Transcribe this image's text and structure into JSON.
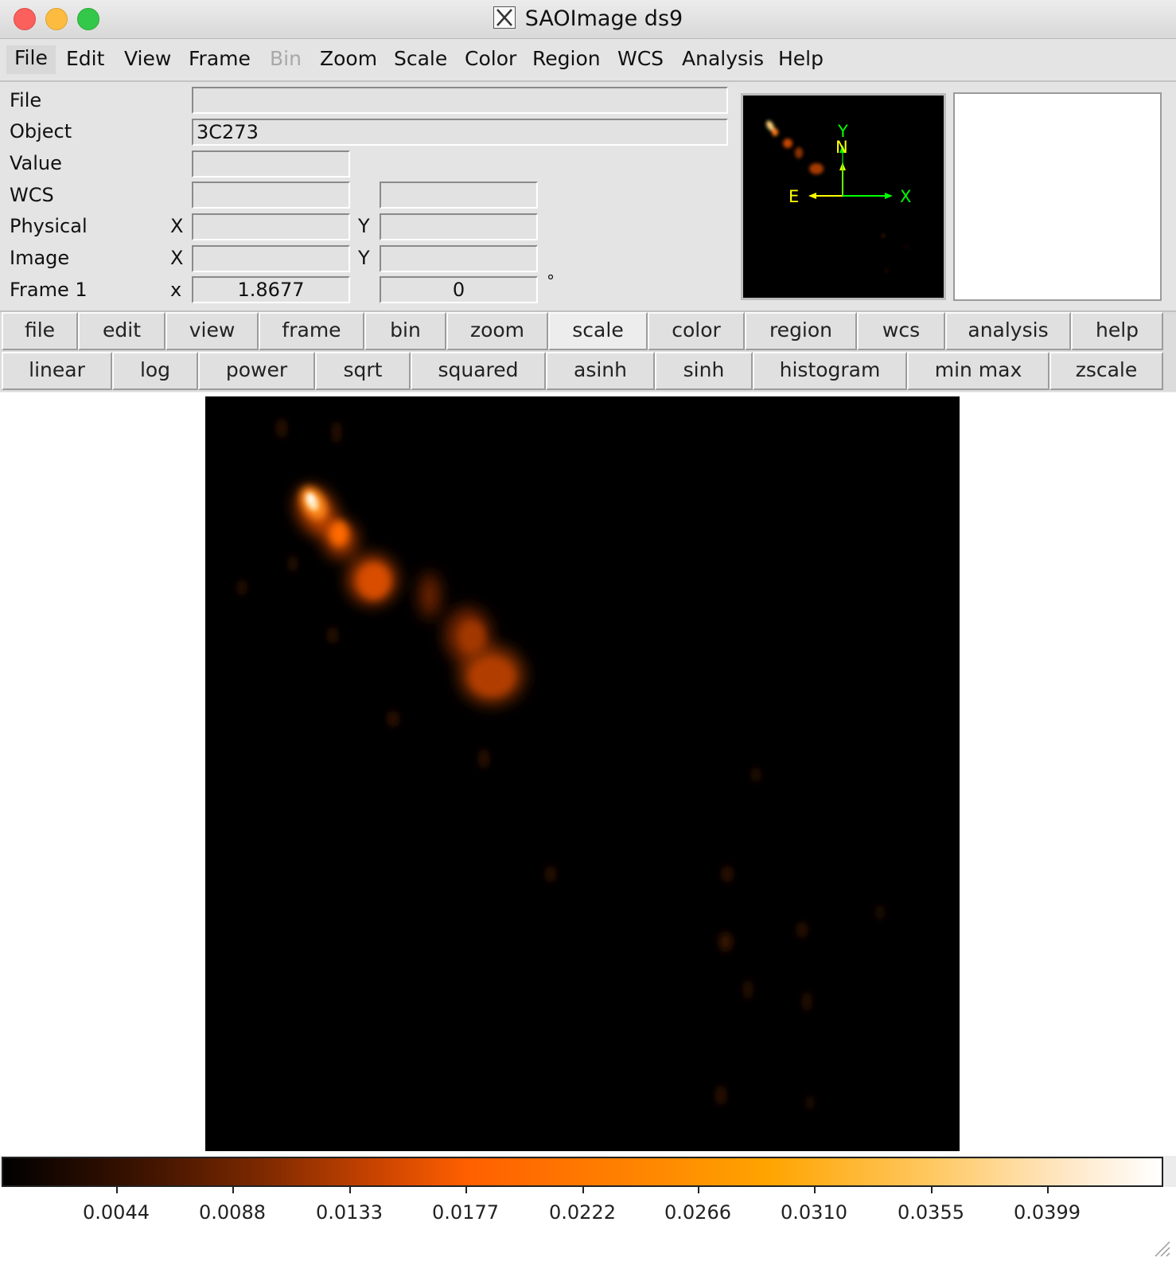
{
  "window": {
    "title": "SAOImage ds9"
  },
  "menubar": {
    "items": [
      "File",
      "Edit",
      "View",
      "Frame",
      "Bin",
      "Zoom",
      "Scale",
      "Color",
      "Region",
      "WCS",
      "Analysis",
      "Help"
    ]
  },
  "info": {
    "labels": {
      "file": "File",
      "object": "Object",
      "value": "Value",
      "wcs": "WCS",
      "physical": "Physical",
      "image": "Image",
      "frame": "Frame 1"
    },
    "axis_x_upper": "X",
    "axis_y_upper": "Y",
    "axis_x_lower": "x",
    "file_value": "",
    "object_value": "3C273",
    "value_value": "",
    "wcs_value_1": "",
    "wcs_value_2": "",
    "physical_x": "",
    "physical_y": "",
    "image_x": "",
    "image_y": "",
    "frame_zoom": "1.8677",
    "frame_angle": "0",
    "degree_symbol": "°"
  },
  "panner": {
    "compass": {
      "north": "N",
      "east": "E",
      "x": "X",
      "y": "Y"
    },
    "colors": {
      "compass": "#ffff00",
      "axes": "#00ff00"
    }
  },
  "buttons_main": [
    "file",
    "edit",
    "view",
    "frame",
    "bin",
    "zoom",
    "scale",
    "color",
    "region",
    "wcs",
    "analysis",
    "help"
  ],
  "buttons_scale": [
    "linear",
    "log",
    "power",
    "sqrt",
    "squared",
    "asinh",
    "sinh",
    "histogram",
    "min max",
    "zscale"
  ],
  "colorbar": {
    "colormap": "heat",
    "tick_labels": [
      "0.0044",
      "0.0088",
      "0.0133",
      "0.0177",
      "0.0222",
      "0.0266",
      "0.0310",
      "0.0355",
      "0.0399"
    ]
  }
}
